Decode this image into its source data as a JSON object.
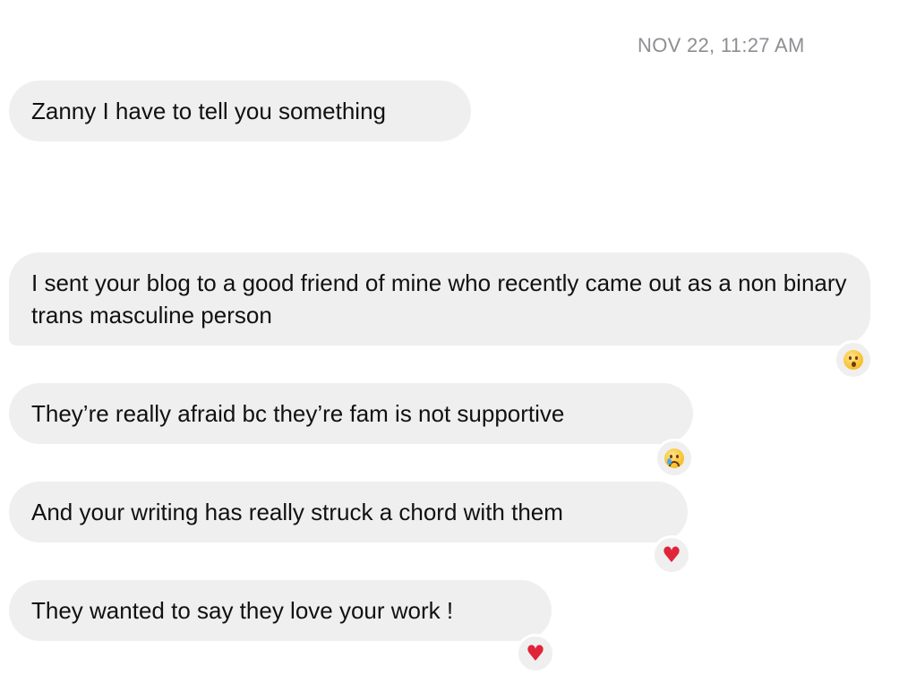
{
  "timestamp": "NOV 22, 11:27 AM",
  "messages": [
    {
      "text": "Zanny I have to tell you something",
      "reaction": null
    },
    {
      "text": "I sent your blog to a good friend of mine who recently came out as a non binary trans masculine person",
      "reaction": "astonished-face"
    },
    {
      "text": "They’re really afraid bc they’re fam is not supportive",
      "reaction": "crying-face"
    },
    {
      "text": "And your writing has really struck a chord with them",
      "reaction": "red-heart"
    },
    {
      "text": "They wanted to say they love your work !",
      "reaction": "red-heart"
    }
  ],
  "colors": {
    "bubble_bg": "#efefef",
    "timestamp": "#8e8e93",
    "heart": "#e0243a"
  }
}
